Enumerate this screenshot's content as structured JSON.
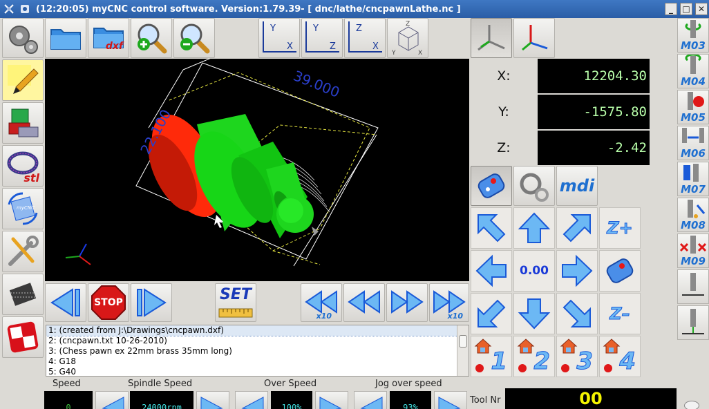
{
  "titlebar": {
    "title": "(12:20:05)  myCNC control software. Version:1.79.39-   [ dnc/lathe/cncpawnLathe.nc ]",
    "minimize": "_",
    "maximize": "□",
    "close": "✕"
  },
  "toolbar": {
    "dxf_label": "dxf",
    "view_xy": {
      "a": "Y",
      "b": "X"
    },
    "view_yz": {
      "a": "Y",
      "b": "Z"
    },
    "view_zx": {
      "a": "Z",
      "b": "X"
    },
    "view_3d": {
      "a": "Z",
      "b": "Y",
      "c": "X"
    }
  },
  "viewport": {
    "dimension_length": "39.000",
    "dimension_diameter": "22.100"
  },
  "dro": {
    "x_label": "X:",
    "x_value": "12204.30",
    "y_label": "Y:",
    "y_value": "-1575.80",
    "z_label": "Z:",
    "z_value": "-2.42"
  },
  "modes": {
    "mdi_label": "mdi"
  },
  "jog": {
    "step_value": "0.00",
    "z_plus": "Z+",
    "z_minus": "Z–",
    "home_numbers": [
      "1",
      "2",
      "3",
      "4"
    ]
  },
  "sidebar": {
    "stl_label": "stl",
    "mycnc_label": "myCNC"
  },
  "mcodes": [
    "M03",
    "M04",
    "M05",
    "M06",
    "M07",
    "M08",
    "M09"
  ],
  "controls": {
    "stop_label": "STOP",
    "set_label": "SET",
    "x10_left": "x10",
    "x10_right": "x10"
  },
  "program": {
    "lines": [
      "1: (created from J:\\Drawings\\cncpawn.dxf)",
      "2: (cncpawn.txt 10-26-2010)",
      "3: (Chess pawn ex 22mm brass 35mm long)",
      "4: G18",
      "5: G40"
    ]
  },
  "speeds": {
    "speed_label": "Speed",
    "speed_value": "0",
    "spindle_label": "Spindle Speed",
    "spindle_value": "24000rpm",
    "over_label": "Over Speed",
    "over_value": "100%",
    "jog_label": "Jog over speed",
    "jog_value": "93%"
  },
  "tool": {
    "label": "Tool Nr",
    "value": "00"
  },
  "colors": {
    "accent": "#1e6fd0",
    "dro_green": "#b9ffaa",
    "red_part": "#ff2a0a",
    "green_part": "#17d617"
  }
}
